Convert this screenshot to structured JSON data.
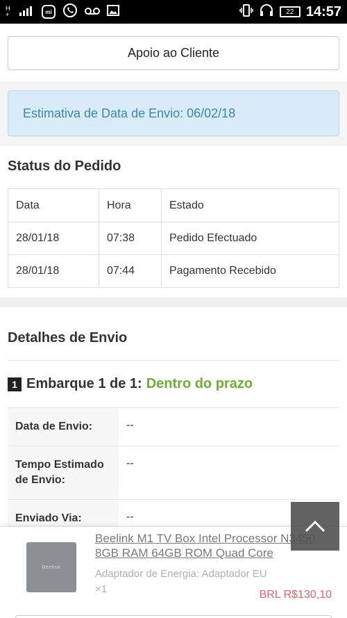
{
  "status_bar": {
    "network_type": "H",
    "network_sub": "+",
    "time": "14:57",
    "battery": "22",
    "icons": [
      "signal-icon",
      "mi-icon",
      "whatsapp-icon",
      "voicemail-icon",
      "image-icon",
      "vibrate-icon",
      "headset-icon",
      "battery-icon"
    ]
  },
  "support": {
    "button_label": "Apoio ao Cliente"
  },
  "estimate": {
    "text": "Estimativa de Data de Envio: 06/02/18"
  },
  "order_status": {
    "title": "Status do Pedido",
    "headers": [
      "Data",
      "Hora",
      "Estado"
    ],
    "rows": [
      [
        "28/01/18",
        "07:38",
        "Pedido Efectuado"
      ],
      [
        "28/01/18",
        "07:44",
        "Pagamento Recebido"
      ]
    ]
  },
  "shipping": {
    "title": "Detalhes de Envio",
    "shipment_number": "1",
    "shipment_label": "Embarque 1 de 1:",
    "shipment_status": "Dentro do prazo",
    "details": [
      {
        "label": "Data de Envio:",
        "value": "--"
      },
      {
        "label": "Tempo Estimado de Envio:",
        "value": "--"
      },
      {
        "label": "Enviado Via:",
        "value": "--"
      }
    ]
  },
  "product": {
    "name": "Beelink M1 TV Box Intel Processor N3450 8GB RAM 64GB ROM Quad Core",
    "option": "Adaptador de Energia: Adaptador EU",
    "quantity": "×1",
    "price": "BRL R$130,10",
    "thumbnail_logo": "Beelink"
  },
  "colors": {
    "accent_info": "#3b87b0",
    "on_time": "#6fad3a",
    "price": "#e2646a"
  }
}
